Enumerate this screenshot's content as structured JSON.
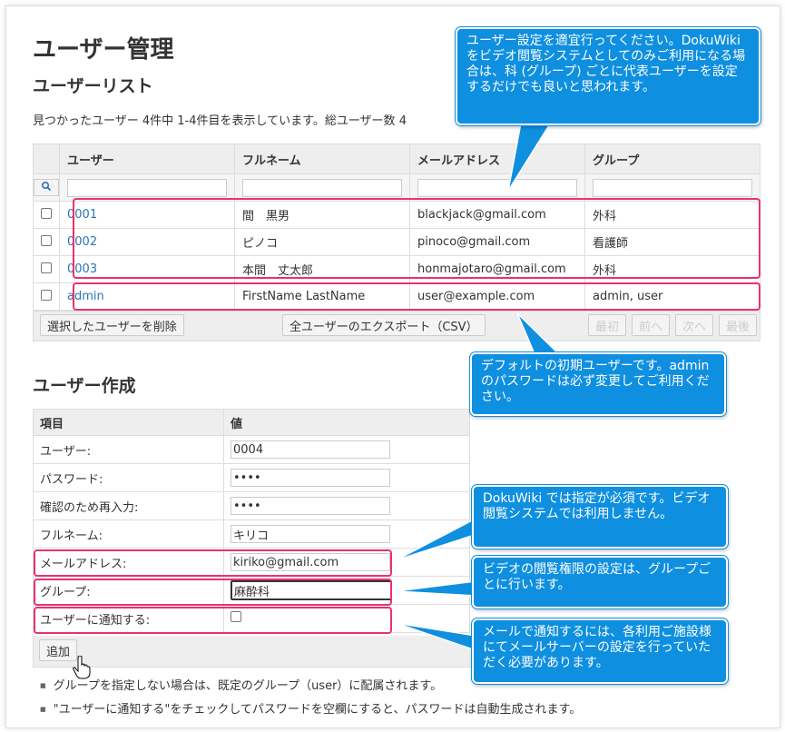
{
  "page": {
    "title": "ユーザー管理",
    "list_heading": "ユーザーリスト",
    "summary": "見つかったユーザー 4件中 1-4件目を表示しています。総ユーザー数 4",
    "create_heading": "ユーザー作成"
  },
  "user_table": {
    "headers": [
      "ユーザー",
      "フルネーム",
      "メールアドレス",
      "グループ"
    ],
    "rows": [
      {
        "user": "0001",
        "fullname": "間　黒男",
        "email": "blackjack@gmail.com",
        "group": "外科"
      },
      {
        "user": "0002",
        "fullname": "ピノコ",
        "email": "pinoco@gmail.com",
        "group": "看護師"
      },
      {
        "user": "0003",
        "fullname": "本間　丈太郎",
        "email": "honmajotaro@gmail.com",
        "group": "外科"
      },
      {
        "user": "admin",
        "fullname": "FirstName LastName",
        "email": "user@example.com",
        "group": "admin, user"
      }
    ],
    "search_icon": "search-icon"
  },
  "list_actions": {
    "delete_selected": "選択したユーザーを削除",
    "export_all": "全ユーザーのエクスポート（CSV）",
    "first": "最初",
    "prev": "前へ",
    "next": "次へ",
    "last": "最後"
  },
  "create_form": {
    "headers": [
      "項目",
      "値"
    ],
    "fields": {
      "user": {
        "label": "ユーザー:",
        "value": "0004"
      },
      "password": {
        "label": "パスワード:",
        "value": "••••"
      },
      "password_confirm": {
        "label": "確認のため再入力:",
        "value": "••••"
      },
      "fullname": {
        "label": "フルネーム:",
        "value": "キリコ"
      },
      "email": {
        "label": "メールアドレス:",
        "value": "kiriko@gmail.com"
      },
      "group": {
        "label": "グループ:",
        "value": "麻酔科"
      },
      "notify": {
        "label": "ユーザーに通知する:",
        "checked": false
      }
    },
    "add_button": "追加"
  },
  "notes": [
    "グループを指定しない場合は、既定のグループ（user）に配属されます。",
    "\"ユーザーに通知する\"をチェックしてパスワードを空欄にすると、パスワードは自動生成されます。"
  ],
  "callouts": {
    "users": "ユーザー設定を適宜行ってください。DokuWiki をビデオ閲覧システムとしてのみご利用になる場合は、科 (グループ) ごとに代表ユーザーを設定するだけでも良いと思われます。",
    "admin": "デフォルトの初期ユーザーです。admin のパスワードは必ず変更してご利用ください。",
    "email": "DokuWiki では指定が必須です。ビデオ閲覧システムでは利用しません。",
    "group": "ビデオの閲覧権限の設定は、グループごとに行います。",
    "notify": "メールで通知するには、各利用ご施設様にてメールサーバーの設定を行っていただく必要があります。"
  },
  "colors": {
    "callout": "#0f8fe0",
    "highlight": "#e8336b",
    "link": "#2b73b7"
  }
}
